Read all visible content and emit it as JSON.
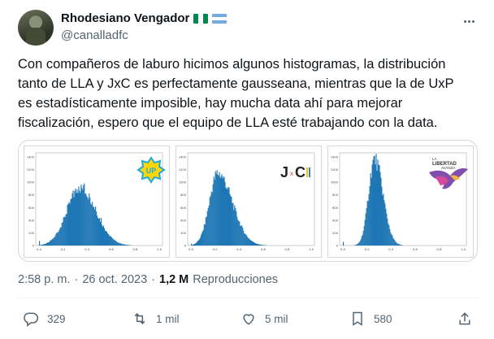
{
  "author": {
    "display_name": "Rhodesiano Vengador",
    "handle": "@canalladfc",
    "flags": [
      {
        "icon": "flag-nigeria-icon",
        "colors": [
          "#008751",
          "#ffffff",
          "#008751"
        ]
      },
      {
        "icon": "flag-argentina-icon",
        "colors": [
          "#74acdf",
          "#ffffff",
          "#74acdf"
        ]
      }
    ]
  },
  "tweet": {
    "text": "Con compañeros de laburo hicimos algunos histogramas, la distribución\ntanto de LLA y JxC es perfectamente gausseana, mientras que la de UxP\nes estadísticamente imposible, hay mucha data ahí para mejorar\nfiscalización, espero que el equipo de LLA esté trabajando con la data."
  },
  "charts": {
    "x_ticks": [
      "0.0",
      "0.2",
      "0.4",
      "0.6",
      "0.8",
      "1.0"
    ],
    "y_ticks": [
      "1400",
      "1200",
      "1000",
      "800",
      "600",
      "400",
      "200",
      "0"
    ],
    "bar_color": "#1f77b4",
    "panels": [
      {
        "logo_text": "UP",
        "logo_colors": [
          "#ffd700",
          "#1fa9e1"
        ]
      },
      {
        "logo_text_left": "J",
        "logo_text_x": "x",
        "logo_text_right": "C"
      },
      {
        "logo_top": "LA",
        "logo_main": "LIBERTAD",
        "logo_sub": "AVANZA"
      }
    ]
  },
  "meta": {
    "time": "2:58 p. m.",
    "date": "26 oct. 2023",
    "separator": "·",
    "views": "1,2 M",
    "views_label": "Reproducciones"
  },
  "actions": {
    "replies": "329",
    "retweets": "1 mil",
    "likes": "5 mil",
    "bookmarks": "580"
  }
}
